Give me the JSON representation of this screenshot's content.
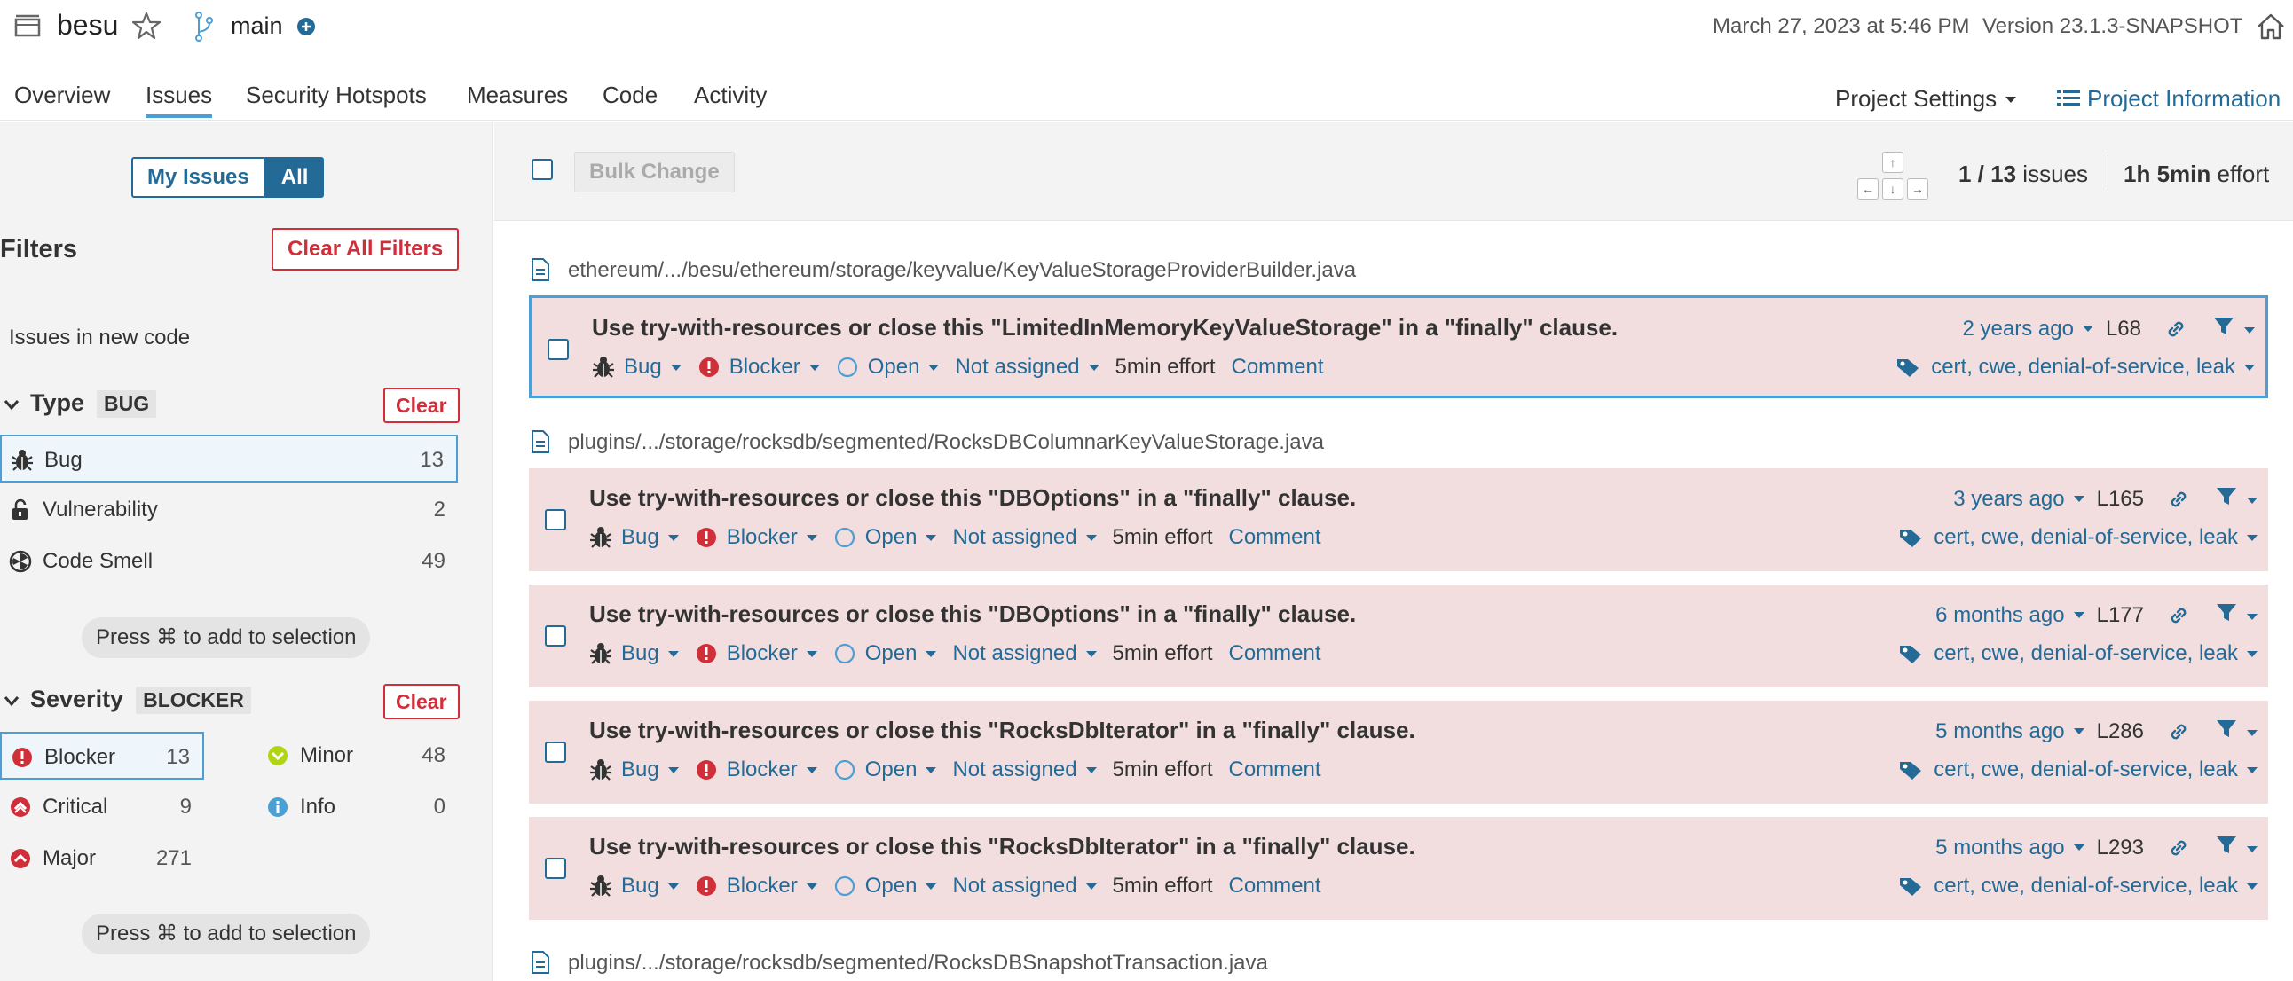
{
  "header": {
    "project": "besu",
    "branch": "main",
    "analysis_date": "March 27, 2023 at 5:46 PM",
    "version": "Version 23.1.3-SNAPSHOT"
  },
  "nav": {
    "tabs": [
      "Overview",
      "Issues",
      "Security Hotspots",
      "Measures",
      "Code",
      "Activity"
    ],
    "active_tab": "Issues",
    "project_settings": "Project Settings",
    "project_info": "Project Information"
  },
  "sidebar": {
    "my_issues": "My Issues",
    "all": "All",
    "filters_title": "Filters",
    "clear_all": "Clear All Filters",
    "new_code": "Issues in new code",
    "type": {
      "title": "Type",
      "tag": "BUG",
      "clear": "Clear",
      "items": [
        {
          "label": "Bug",
          "count": "13",
          "icon": "bug-icon"
        },
        {
          "label": "Vulnerability",
          "count": "2",
          "icon": "lock-icon"
        },
        {
          "label": "Code Smell",
          "count": "49",
          "icon": "code-smell-icon"
        }
      ]
    },
    "press_hint": "Press ⌘ to add to selection",
    "severity": {
      "title": "Severity",
      "tag": "BLOCKER",
      "clear": "Clear",
      "items": [
        {
          "label": "Blocker",
          "count": "13",
          "icon": "blocker-icon"
        },
        {
          "label": "Minor",
          "count": "48",
          "icon": "minor-icon"
        },
        {
          "label": "Critical",
          "count": "9",
          "icon": "critical-icon"
        },
        {
          "label": "Info",
          "count": "0",
          "icon": "info-icon"
        },
        {
          "label": "Major",
          "count": "271",
          "icon": "major-icon"
        }
      ]
    }
  },
  "toolbar": {
    "bulk_change": "Bulk Change",
    "keys": {
      "up": "↑",
      "left": "←",
      "down": "↓",
      "right": "→"
    },
    "count_current": "1 / 13",
    "count_label": "issues",
    "effort_value": "1h 5min",
    "effort_label": "effort"
  },
  "files": [
    "ethereum/.../besu/ethereum/storage/keyvalue/KeyValueStorageProviderBuilder.java",
    "plugins/.../storage/rocksdb/segmented/RocksDBColumnarKeyValueStorage.java",
    "plugins/.../storage/rocksdb/segmented/RocksDBSnapshotTransaction.java"
  ],
  "issue_common": {
    "type": "Bug",
    "severity": "Blocker",
    "status": "Open",
    "assignee": "Not assigned",
    "effort": "5min effort",
    "comment": "Comment",
    "tags": "cert, cwe, denial-of-service, leak"
  },
  "issues": [
    {
      "message": "Use try-with-resources or close this \"LimitedInMemoryKeyValueStorage\" in a \"finally\" clause.",
      "age": "2 years ago",
      "line": "L68"
    },
    {
      "message": "Use try-with-resources or close this \"DBOptions\" in a \"finally\" clause.",
      "age": "3 years ago",
      "line": "L165"
    },
    {
      "message": "Use try-with-resources or close this \"DBOptions\" in a \"finally\" clause.",
      "age": "6 months ago",
      "line": "L177"
    },
    {
      "message": "Use try-with-resources or close this \"RocksDbIterator\" in a \"finally\" clause.",
      "age": "5 months ago",
      "line": "L286"
    },
    {
      "message": "Use try-with-resources or close this \"RocksDbIterator\" in a \"finally\" clause.",
      "age": "5 months ago",
      "line": "L293"
    }
  ],
  "colors": {
    "accent": "#236a97",
    "issue_bg": "#f2dede",
    "danger": "#d02f3a",
    "focus": "#4b9fd5"
  }
}
